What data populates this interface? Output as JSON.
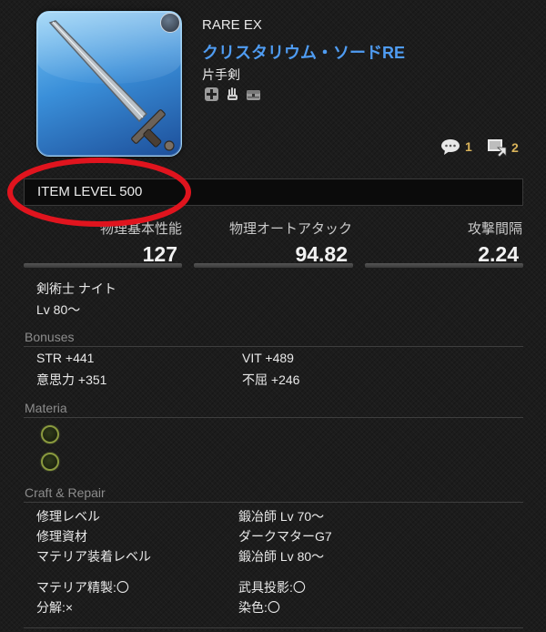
{
  "item": {
    "rarity": "RARE EX",
    "name": "クリスタリウム・ソードRE",
    "category": "片手剣",
    "item_level": "ITEM LEVEL 500",
    "comment_count": "1",
    "share_count": "2",
    "badge_icons": [
      "repair-cross-icon",
      "glove-icon",
      "chest-icon"
    ]
  },
  "stats": [
    {
      "label": "物理基本性能",
      "value": "127"
    },
    {
      "label": "物理オートアタック",
      "value": "94.82"
    },
    {
      "label": "攻撃間隔",
      "value": "2.24"
    }
  ],
  "requirements": {
    "classes": "剣術士 ナイト",
    "level": "Lv 80～"
  },
  "bonuses": {
    "title": "Bonuses",
    "items": [
      "STR +441",
      "意思力 +351",
      "VIT +489",
      "不屈 +246"
    ]
  },
  "materia": {
    "title": "Materia",
    "slots": 2
  },
  "craft": {
    "title": "Craft & Repair",
    "rows": [
      {
        "label": "修理レベル",
        "value": "鍛冶師 Lv 70～"
      },
      {
        "label": "修理資材",
        "value": "ダークマターG7"
      },
      {
        "label": "マテリア装着レベル",
        "value": "鍛冶師 Lv 80～"
      }
    ],
    "misc": [
      "マテリア精製:〇",
      "分解:×",
      "武具投影:〇",
      "染色:〇"
    ]
  },
  "colors": {
    "name_blue": "#4f9cf2",
    "count_gold": "#d9b35a",
    "annotation_red": "#e0141e",
    "materia_ring": "#8a9a3e"
  }
}
